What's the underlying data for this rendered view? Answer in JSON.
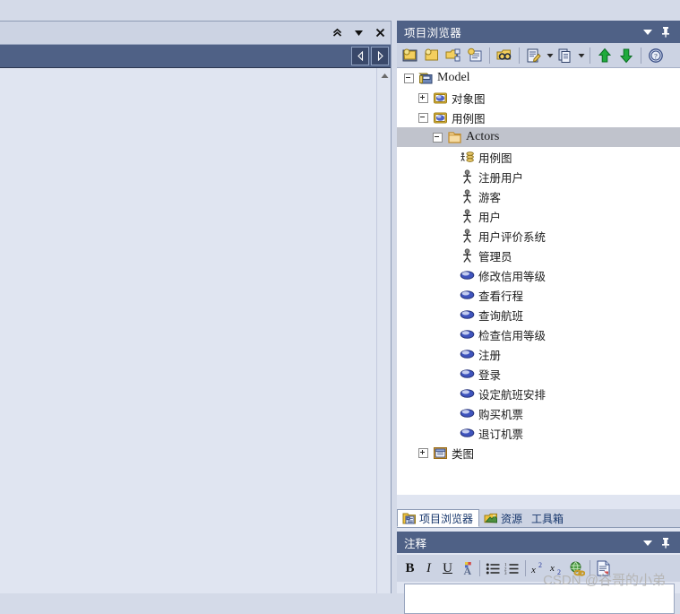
{
  "window": {
    "background_color": "#d4dae8"
  },
  "left_pane": {
    "caption_buttons": [
      {
        "name": "chevron-up-icon",
        "label": "»"
      },
      {
        "name": "dropdown-arrow-icon",
        "label": "▾"
      },
      {
        "name": "close-icon",
        "label": "✕"
      }
    ],
    "nav_buttons": [
      {
        "name": "nav-back-icon",
        "label": "◁"
      },
      {
        "name": "nav-forward-icon",
        "label": "▷"
      }
    ]
  },
  "project_browser": {
    "title": "项目浏览器",
    "title_buttons": [
      {
        "name": "dropdown-arrow-icon",
        "label": "▾"
      },
      {
        "name": "pin-icon",
        "label": "⚐"
      }
    ],
    "toolbar": [
      {
        "name": "new-model-icon",
        "tip": "new-model"
      },
      {
        "name": "new-package-icon",
        "tip": "new-package"
      },
      {
        "name": "new-diagram-icon",
        "tip": "new-diagram"
      },
      {
        "name": "new-element-icon",
        "tip": "new-element"
      },
      {
        "name": "search-folder-icon",
        "tip": "search"
      },
      {
        "name": "properties-icon",
        "tip": "properties"
      },
      {
        "name": "copy-icon",
        "tip": "copy"
      },
      {
        "name": "move-up-icon",
        "tip": "move-up"
      },
      {
        "name": "move-down-icon",
        "tip": "move-down"
      },
      {
        "name": "help-icon",
        "tip": "help"
      }
    ],
    "tree": [
      {
        "label": "Model",
        "icon": "model-icon",
        "indent": 0,
        "toggle": "minus",
        "selected": false,
        "font": "serif"
      },
      {
        "label": "对象图",
        "icon": "diagram-icon",
        "indent": 1,
        "toggle": "plus",
        "selected": false,
        "font": "sans"
      },
      {
        "label": "用例图",
        "icon": "diagram-icon",
        "indent": 1,
        "toggle": "minus",
        "selected": false,
        "font": "sans"
      },
      {
        "label": "Actors",
        "icon": "folder-icon",
        "indent": 2,
        "toggle": "minus",
        "selected": true,
        "font": "serif"
      },
      {
        "label": "用例图",
        "icon": "usecase-diagram-icon",
        "indent": 3,
        "toggle": "none",
        "selected": false,
        "font": "sans"
      },
      {
        "label": "注册用户",
        "icon": "actor-icon",
        "indent": 3,
        "toggle": "none",
        "selected": false,
        "font": "sans"
      },
      {
        "label": "游客",
        "icon": "actor-icon",
        "indent": 3,
        "toggle": "none",
        "selected": false,
        "font": "sans"
      },
      {
        "label": "用户",
        "icon": "actor-icon",
        "indent": 3,
        "toggle": "none",
        "selected": false,
        "font": "sans"
      },
      {
        "label": "用户评价系统",
        "icon": "actor-icon",
        "indent": 3,
        "toggle": "none",
        "selected": false,
        "font": "sans"
      },
      {
        "label": "管理员",
        "icon": "actor-icon",
        "indent": 3,
        "toggle": "none",
        "selected": false,
        "font": "sans"
      },
      {
        "label": "修改信用等级",
        "icon": "usecase-icon",
        "indent": 3,
        "toggle": "none",
        "selected": false,
        "font": "sans"
      },
      {
        "label": "查看行程",
        "icon": "usecase-icon",
        "indent": 3,
        "toggle": "none",
        "selected": false,
        "font": "sans"
      },
      {
        "label": "查询航班",
        "icon": "usecase-icon",
        "indent": 3,
        "toggle": "none",
        "selected": false,
        "font": "sans"
      },
      {
        "label": "检查信用等级",
        "icon": "usecase-icon",
        "indent": 3,
        "toggle": "none",
        "selected": false,
        "font": "sans"
      },
      {
        "label": "注册",
        "icon": "usecase-icon",
        "indent": 3,
        "toggle": "none",
        "selected": false,
        "font": "sans"
      },
      {
        "label": "登录",
        "icon": "usecase-icon",
        "indent": 3,
        "toggle": "none",
        "selected": false,
        "font": "sans"
      },
      {
        "label": "设定航班安排",
        "icon": "usecase-icon",
        "indent": 3,
        "toggle": "none",
        "selected": false,
        "font": "sans"
      },
      {
        "label": "购买机票",
        "icon": "usecase-icon",
        "indent": 3,
        "toggle": "none",
        "selected": false,
        "font": "sans"
      },
      {
        "label": "退订机票",
        "icon": "usecase-icon",
        "indent": 3,
        "toggle": "none",
        "selected": false,
        "font": "sans"
      },
      {
        "label": "类图",
        "icon": "class-diagram-icon",
        "indent": 1,
        "toggle": "plus",
        "selected": false,
        "font": "sans"
      }
    ],
    "highlight": {
      "color": "#ff2014",
      "note": "red annotation rectangle around Actors folder and its six actor children"
    }
  },
  "tabs": [
    {
      "label": "项目浏览器",
      "icon": "project-browser-icon",
      "active": true
    },
    {
      "label": "资源",
      "icon": "resources-icon",
      "active": false
    },
    {
      "label": "工具箱",
      "icon": "toolbox-icon",
      "active": false
    }
  ],
  "notes": {
    "title": "注释",
    "title_buttons": [
      {
        "name": "dropdown-arrow-icon",
        "label": "▾"
      },
      {
        "name": "pin-icon",
        "label": "⚐"
      }
    ],
    "toolbar": [
      {
        "name": "bold-icon",
        "label": "B"
      },
      {
        "name": "italic-icon",
        "label": "I"
      },
      {
        "name": "underline-icon",
        "label": "U"
      },
      {
        "name": "font-color-icon",
        "label": "A"
      },
      {
        "name": "bullet-list-icon",
        "label": "list"
      },
      {
        "name": "numbered-list-icon",
        "label": "list"
      },
      {
        "name": "superscript-icon",
        "label": "x"
      },
      {
        "name": "subscript-icon",
        "label": "x"
      },
      {
        "name": "hyperlink-icon",
        "label": "link"
      },
      {
        "name": "document-icon",
        "label": "doc"
      }
    ],
    "editor_value": ""
  },
  "watermark": {
    "text": "CSDN @谷哥的小弟",
    "color": "#b6b6b6"
  }
}
